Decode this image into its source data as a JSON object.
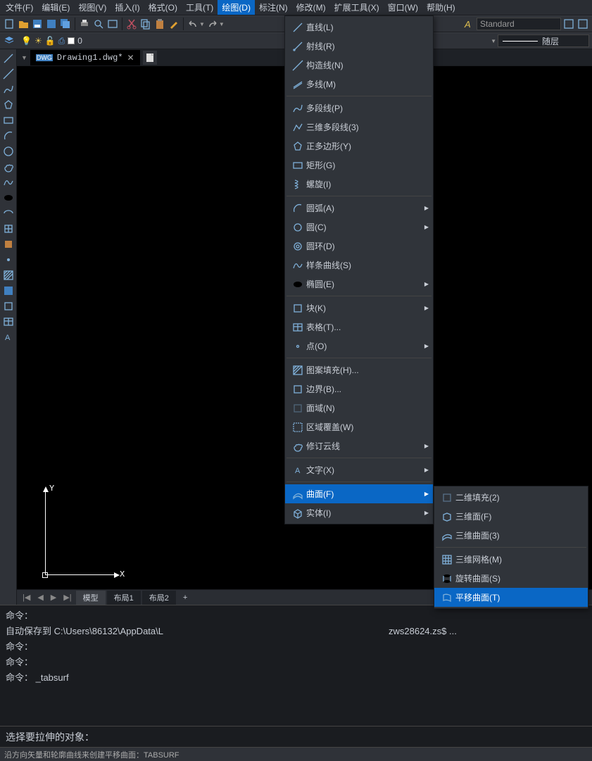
{
  "menubar": {
    "items": [
      {
        "label": "文件(F)"
      },
      {
        "label": "编辑(E)"
      },
      {
        "label": "视图(V)"
      },
      {
        "label": "插入(I)"
      },
      {
        "label": "格式(O)"
      },
      {
        "label": "工具(T)"
      },
      {
        "label": "绘图(D)",
        "active": true
      },
      {
        "label": "标注(N)"
      },
      {
        "label": "修改(M)"
      },
      {
        "label": "扩展工具(X)"
      },
      {
        "label": "窗口(W)"
      },
      {
        "label": "帮助(H)"
      }
    ]
  },
  "toolbar2": {
    "layer_value": "0",
    "style_value": "Standard",
    "linetype_value": "随层"
  },
  "tabs": {
    "active": {
      "title": "Drawing1.dwg*"
    }
  },
  "axis": {
    "x": "X",
    "y": "Y"
  },
  "layout_tabs": {
    "items": [
      {
        "label": "模型",
        "active": true
      },
      {
        "label": "布局1"
      },
      {
        "label": "布局2"
      }
    ]
  },
  "cmd": {
    "lines": [
      "命令：",
      "自动保存到  C:\\Users\\86132\\AppData\\L",
      "命令：",
      "命令：",
      "命令：  _tabsurf"
    ],
    "extra": "zws28624.zs$ ...",
    "prompt": "选择要拉伸的对象："
  },
  "statusbar": {
    "text": "沿方向矢量和轮廓曲线来创建平移曲面：TABSURF"
  },
  "draw_menu": {
    "items": [
      {
        "icon": "line",
        "label": "直线(L)"
      },
      {
        "icon": "ray",
        "label": "射线(R)"
      },
      {
        "icon": "xline",
        "label": "构造线(N)"
      },
      {
        "icon": "mline",
        "label": "多线(M)"
      },
      {
        "sep": true
      },
      {
        "icon": "pline",
        "label": "多段线(P)"
      },
      {
        "icon": "3dpoly",
        "label": "三维多段线(3)"
      },
      {
        "icon": "polygon",
        "label": "正多边形(Y)"
      },
      {
        "icon": "rect",
        "label": "矩形(G)"
      },
      {
        "icon": "helix",
        "label": "螺旋(I)"
      },
      {
        "sep": true
      },
      {
        "icon": "arc",
        "label": "圆弧(A)",
        "sub": true
      },
      {
        "icon": "circle",
        "label": "圆(C)",
        "sub": true
      },
      {
        "icon": "donut",
        "label": "圆环(D)"
      },
      {
        "icon": "spline",
        "label": "样条曲线(S)"
      },
      {
        "icon": "ellipse",
        "label": "椭圆(E)",
        "sub": true
      },
      {
        "sep": true
      },
      {
        "icon": "block",
        "label": "块(K)",
        "sub": true
      },
      {
        "icon": "table",
        "label": "表格(T)..."
      },
      {
        "icon": "point",
        "label": "点(O)",
        "sub": true
      },
      {
        "sep": true
      },
      {
        "icon": "hatch",
        "label": "图案填充(H)..."
      },
      {
        "icon": "boundary",
        "label": "边界(B)..."
      },
      {
        "icon": "region",
        "label": "面域(N)"
      },
      {
        "icon": "wipeout",
        "label": "区域覆盖(W)"
      },
      {
        "icon": "revcloud",
        "label": "修订云线",
        "sub": true
      },
      {
        "sep": true
      },
      {
        "icon": "text",
        "label": "文字(X)",
        "sub": true
      },
      {
        "sep": true
      },
      {
        "icon": "surface",
        "label": "曲面(F)",
        "sub": true,
        "highlighted": true
      },
      {
        "icon": "solid",
        "label": "实体(I)",
        "sub": true
      }
    ]
  },
  "surface_submenu": {
    "items": [
      {
        "icon": "2dsolid",
        "label": "二维填充(2)"
      },
      {
        "icon": "3dface",
        "label": "三维面(F)"
      },
      {
        "icon": "3dsurf",
        "label": "三维曲面(3)"
      },
      {
        "sep": true
      },
      {
        "icon": "3dmesh",
        "label": "三维网格(M)"
      },
      {
        "icon": "revsurf",
        "label": "旋转曲面(S)"
      },
      {
        "icon": "tabsurf",
        "label": "平移曲面(T)",
        "highlighted": true
      }
    ]
  }
}
